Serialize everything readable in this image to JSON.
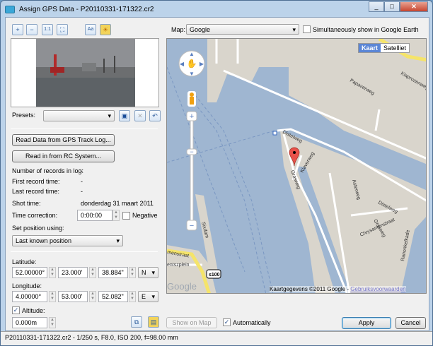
{
  "window": {
    "title": "Assign GPS Data - P20110331-171322.cr2",
    "minimize": "_",
    "maximize": "□",
    "close": "✕"
  },
  "toolbar": {
    "icons": [
      "zoom-in-icon",
      "zoom-out-icon",
      "actual-size-icon",
      "fit-icon",
      "text-icon",
      "image-icon"
    ],
    "zoom_in": "+",
    "zoom_out": "−",
    "actual": "1:1",
    "fit": "⛶",
    "text": "Aa",
    "image": "☀"
  },
  "presets": {
    "label": "Presets:",
    "value": ""
  },
  "buttons": {
    "read_gps": "Read Data from GPS Track Log...",
    "read_rc": "Read in from RC System...",
    "show_on_map": "Show on Map",
    "apply": "Apply",
    "cancel": "Cancel"
  },
  "info": {
    "records_label": "Number of records in log:",
    "records_value": "-",
    "first_label": "First record time:",
    "first_value": "-",
    "last_label": "Last record time:",
    "last_value": "-",
    "shot_label": "Shot time:",
    "shot_value": "donderdag 31 maart 2011",
    "correction_label": "Time correction:",
    "correction_value": "0:00:00",
    "negative_label": "Negative",
    "negative_checked": false,
    "setpos_label": "Set position using:",
    "setpos_value": "Last known position"
  },
  "latitude": {
    "label": "Latitude:",
    "deg": "52.00000°",
    "min": "23.000'",
    "sec": "38.884\"",
    "dir": "N"
  },
  "longitude": {
    "label": "Longitude:",
    "deg": "4.00000°",
    "min": "53.000'",
    "sec": "52.082\"",
    "dir": "E"
  },
  "altitude": {
    "label": "Altitude:",
    "checked": true,
    "value": "0.000m"
  },
  "automatically": {
    "label": "Automatically",
    "checked": true
  },
  "map": {
    "label": "Map:",
    "provider": "Google",
    "earth_label": "Simultaneously show in Google Earth",
    "earth_checked": false,
    "type_kaart": "Kaart",
    "type_satelliet": "Satelliet",
    "streets": [
      "Papaverweg",
      "Distelweg",
      "Klaverweg",
      "Grasweg",
      "Asterweg",
      "Chrysantenstraat",
      "Ranonkelkade",
      "Klaprozenweg",
      "Sixdam",
      "menstraat",
      "entszplein",
      "Distelweg"
    ],
    "route": "s100",
    "logo": "Google",
    "copyright": "Kaartgegevens ©2011 Google - ",
    "terms": "Gebruiksvoorwaarden"
  },
  "status": "P20110331-171322.cr2 - 1/250 s, F8.0, ISO 200, f=98.00 mm"
}
